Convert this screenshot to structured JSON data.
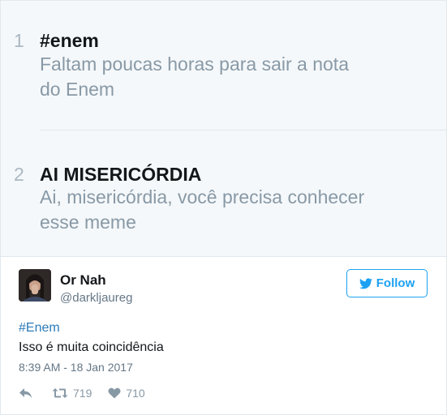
{
  "trends": [
    {
      "rank": "1",
      "name": "#enem",
      "description_line1": "Faltam poucas horas para sair a nota",
      "description_line2": "do Enem"
    },
    {
      "rank": "2",
      "name": "AI MISERICÓRDIA",
      "description_line1": "Ai, misericórdia, você precisa conhecer",
      "description_line2": "esse meme"
    }
  ],
  "tweet": {
    "display_name": "Or Nah",
    "handle": "@darkljaureg",
    "follow_label": "Follow",
    "hashtag": "#Enem",
    "text": "Isso é muita coincidência",
    "timestamp": "8:39 AM - 18 Jan 2017",
    "retweets": "719",
    "likes": "710"
  },
  "icons": {
    "follow": "twitter-bird-icon",
    "reply": "reply-icon",
    "retweet": "retweet-icon",
    "like": "heart-icon"
  },
  "colors": {
    "accent": "#1da1f2",
    "hashtag": "#2b7bb9",
    "muted": "#8899a6",
    "panel_bg": "#f5f8fa"
  }
}
